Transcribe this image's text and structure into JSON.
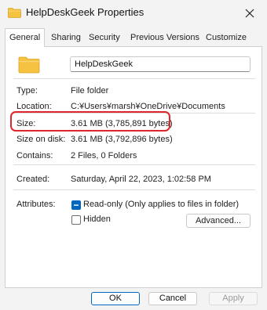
{
  "window": {
    "title": "HelpDeskGeek Properties",
    "close_glyph": "✕",
    "title_icon": "folder-icon"
  },
  "tabs": [
    {
      "label": "General",
      "active": true
    },
    {
      "label": "Sharing",
      "active": false
    },
    {
      "label": "Security",
      "active": false
    },
    {
      "label": "Previous Versions",
      "active": false
    },
    {
      "label": "Customize",
      "active": false
    }
  ],
  "general": {
    "folder_icon": "folder-icon",
    "name_value": "HelpDeskGeek",
    "type_label": "Type:",
    "type_value": "File folder",
    "location_label": "Location:",
    "location_value": "C:¥Users¥marsh¥OneDrive¥Documents",
    "size_label": "Size:",
    "size_value": "3.61 MB (3,785,891 bytes)",
    "size_on_disk_label": "Size on disk:",
    "size_on_disk_value": "3.61 MB (3,792,896 bytes)",
    "contains_label": "Contains:",
    "contains_value": "2 Files, 0 Folders",
    "created_label": "Created:",
    "created_value": "Saturday, April 22, 2023, 1:02:58 PM",
    "attributes_label": "Attributes:",
    "readonly_label": "Read-only (Only applies to files in folder)",
    "readonly_checked": true,
    "hidden_label": "Hidden",
    "hidden_checked": false,
    "advanced_label": "Advanced..."
  },
  "footer": {
    "ok_label": "OK",
    "cancel_label": "Cancel",
    "apply_label": "Apply"
  },
  "colors": {
    "accent": "#0067c0",
    "highlight": "#e0262b",
    "folder": "#f5c242"
  }
}
